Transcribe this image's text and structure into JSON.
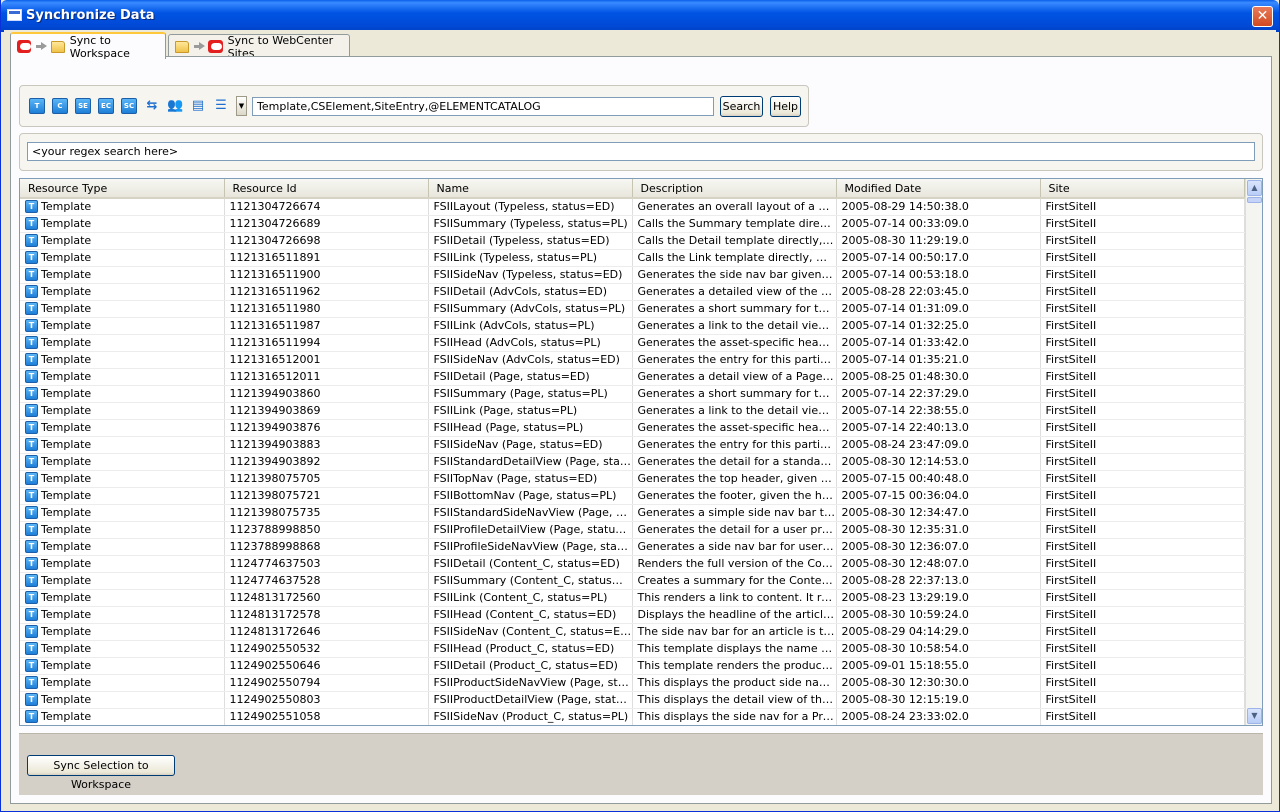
{
  "window": {
    "title": "Synchronize Data",
    "close_glyph": "✕"
  },
  "tabs": [
    {
      "label": "Sync to Workspace",
      "active": true
    },
    {
      "label": "Sync to WebCenter Sites",
      "active": false
    }
  ],
  "toolbar": {
    "icon_buttons": [
      "T",
      "C",
      "SE",
      "EC",
      "SC"
    ],
    "resource_types_value": "Template,CSElement,SiteEntry,@ELEMENTCATALOG",
    "search_label": "Search",
    "help_label": "Help"
  },
  "regex": {
    "value": "<your regex search here>"
  },
  "table": {
    "columns": [
      "Resource Type",
      "Resource Id",
      "Name",
      "Description",
      "Modified Date",
      "Site"
    ],
    "rows": [
      [
        "Template",
        "1121304726674",
        "FSIILayout (Typeless, status=ED)",
        "Generates an overall layout of a pag...",
        "2005-08-29 14:50:38.0",
        "FirstSiteII"
      ],
      [
        "Template",
        "1121304726689",
        "FSIISummary (Typeless, status=PL)",
        "Calls the Summary template directly, ...",
        "2005-07-14 00:33:09.0",
        "FirstSiteII"
      ],
      [
        "Template",
        "1121304726698",
        "FSIIDetail (Typeless, status=ED)",
        "Calls the Detail template directly, wit...",
        "2005-08-30 11:29:19.0",
        "FirstSiteII"
      ],
      [
        "Template",
        "1121316511891",
        "FSIILink (Typeless, status=PL)",
        "Calls the Link template directly, with ...",
        "2005-07-14 00:50:17.0",
        "FirstSiteII"
      ],
      [
        "Template",
        "1121316511900",
        "FSIISideNav (Typeless, status=ED)",
        "Generates the side nav bar given c, c...",
        "2005-07-14 00:53:18.0",
        "FirstSiteII"
      ],
      [
        "Template",
        "1121316511962",
        "FSIIDetail (AdvCols, status=ED)",
        "Generates a detailed view of the asset.",
        "2005-08-28 22:03:45.0",
        "FirstSiteII"
      ],
      [
        "Template",
        "1121316511980",
        "FSIISummary (AdvCols, status=PL)",
        "Generates a short summary for the a...",
        "2005-07-14 01:31:09.0",
        "FirstSiteII"
      ],
      [
        "Template",
        "1121316511987",
        "FSIILink (AdvCols, status=PL)",
        "Generates a link to the detail view for...",
        "2005-07-14 01:32:25.0",
        "FirstSiteII"
      ],
      [
        "Template",
        "1121316511994",
        "FSIIHead (AdvCols, status=PL)",
        "Generates the asset-specific header ...",
        "2005-07-14 01:33:42.0",
        "FirstSiteII"
      ],
      [
        "Template",
        "1121316512001",
        "FSIISideNav (AdvCols, status=ED)",
        "Generates the entry for this particula...",
        "2005-07-14 01:35:21.0",
        "FirstSiteII"
      ],
      [
        "Template",
        "1121316512011",
        "FSIIDetail (Page, status=ED)",
        "Generates a detail view of a Page.  It...",
        "2005-08-25 01:48:30.0",
        "FirstSiteII"
      ],
      [
        "Template",
        "1121394903860",
        "FSIISummary (Page, status=PL)",
        "Generates a short summary for the a...",
        "2005-07-14 22:37:29.0",
        "FirstSiteII"
      ],
      [
        "Template",
        "1121394903869",
        "FSIILink (Page, status=PL)",
        "Generates a link to the detail view for...",
        "2005-07-14 22:38:55.0",
        "FirstSiteII"
      ],
      [
        "Template",
        "1121394903876",
        "FSIIHead (Page, status=PL)",
        "Generates the asset-specific header ...",
        "2005-07-14 22:40:13.0",
        "FirstSiteII"
      ],
      [
        "Template",
        "1121394903883",
        "FSIISideNav (Page, status=ED)",
        "Generates the entry for this particula...",
        "2005-08-24 23:47:09.0",
        "FirstSiteII"
      ],
      [
        "Template",
        "1121394903892",
        "FSIIStandardDetailView (Page, statu...",
        "Generates the detail for a standard p...",
        "2005-08-30 12:14:53.0",
        "FirstSiteII"
      ],
      [
        "Template",
        "1121398075705",
        "FSIITopNav (Page, status=ED)",
        "Generates the top header, given the ...",
        "2005-07-15 00:40:48.0",
        "FirstSiteII"
      ],
      [
        "Template",
        "1121398075721",
        "FSIIBottomNav (Page, status=PL)",
        "Generates the footer, given the hom...",
        "2005-07-15 00:36:04.0",
        "FirstSiteII"
      ],
      [
        "Template",
        "1121398075735",
        "FSIIStandardSideNavView (Page, stat...",
        "Generates a simple side nav bar that ...",
        "2005-08-30 12:34:47.0",
        "FirstSiteII"
      ],
      [
        "Template",
        "1123788998850",
        "FSIIProfileDetailView (Page, status=ED)",
        "Generates the detail for a user profil...",
        "2005-08-30 12:35:31.0",
        "FirstSiteII"
      ],
      [
        "Template",
        "1123788998868",
        "FSIIProfileSideNavView (Page, status...",
        "Generates a side nav bar for user pr...",
        "2005-08-30 12:36:07.0",
        "FirstSiteII"
      ],
      [
        "Template",
        "1124774637503",
        "FSIIDetail (Content_C, status=ED)",
        "Renders the full version of the Conte...",
        "2005-08-30 12:48:07.0",
        "FirstSiteII"
      ],
      [
        "Template",
        "1124774637528",
        "FSIISummary (Content_C, status=ED)",
        "Creates a summary for the Content_...",
        "2005-08-28 22:37:13.0",
        "FirstSiteII"
      ],
      [
        "Template",
        "1124813172560",
        "FSIILink (Content_C, status=PL)",
        "This renders a link to content.  It req...",
        "2005-08-23 13:29:19.0",
        "FirstSiteII"
      ],
      [
        "Template",
        "1124813172578",
        "FSIIHead (Content_C, status=ED)",
        "Displays the headline of the article fo...",
        "2005-08-30 10:59:24.0",
        "FirstSiteII"
      ],
      [
        "Template",
        "1124813172646",
        "FSIISideNav (Content_C, status=ED)",
        "The side nav bar for an article is the ...",
        "2005-08-29 04:14:29.0",
        "FirstSiteII"
      ],
      [
        "Template",
        "1124902550532",
        "FSIIHead (Product_C, status=ED)",
        "This template displays the name of th...",
        "2005-08-30 10:58:54.0",
        "FirstSiteII"
      ],
      [
        "Template",
        "1124902550646",
        "FSIIDetail (Product_C, status=ED)",
        "This template renders the product an...",
        "2005-09-01 15:18:55.0",
        "FirstSiteII"
      ],
      [
        "Template",
        "1124902550794",
        "FSIIProductSideNavView (Page, stat...",
        "This displays the product side nav ba...",
        "2005-08-30 12:30:30.0",
        "FirstSiteII"
      ],
      [
        "Template",
        "1124902550803",
        "FSIIProductDetailView (Page, status...",
        "This displays the detail view of the pr...",
        "2005-08-30 12:15:19.0",
        "FirstSiteII"
      ],
      [
        "Template",
        "1124902551058",
        "FSIISideNav (Product_C, status=PL)",
        "This displays the side nav for a Produ...",
        "2005-08-24 23:33:02.0",
        "FirstSiteII"
      ]
    ]
  },
  "footer": {
    "sync_button_label": "Sync Selection to Workspace"
  }
}
